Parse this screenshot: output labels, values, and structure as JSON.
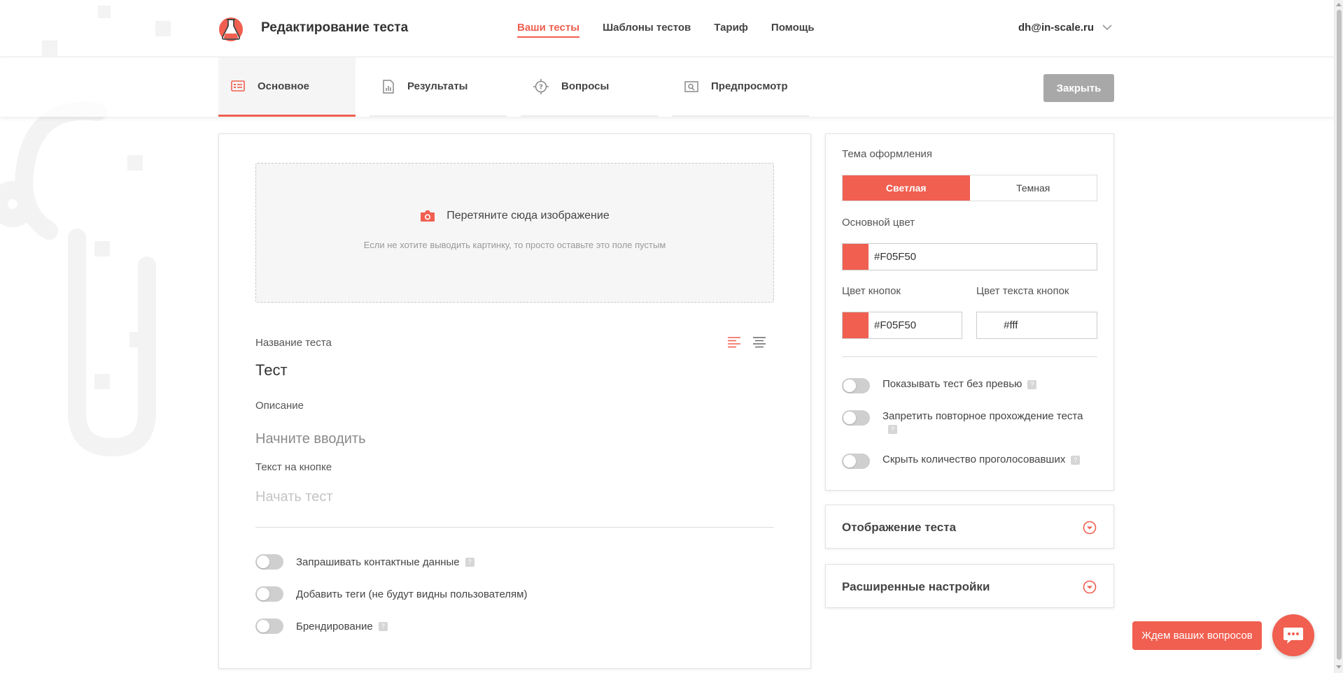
{
  "header": {
    "title": "Редактирование теста",
    "nav": [
      {
        "label": "Ваши тесты",
        "active": true
      },
      {
        "label": "Шаблоны тестов",
        "active": false
      },
      {
        "label": "Тариф",
        "active": false
      },
      {
        "label": "Помощь",
        "active": false
      }
    ],
    "user_email": "dh@in-scale.ru"
  },
  "tabs": [
    {
      "label": "Основное",
      "icon": "form-icon",
      "active": true
    },
    {
      "label": "Результаты",
      "icon": "chart-icon",
      "active": false
    },
    {
      "label": "Вопросы",
      "icon": "target-question-icon",
      "active": false
    },
    {
      "label": "Предпросмотр",
      "icon": "preview-icon",
      "active": false
    }
  ],
  "close_label": "Закрыть",
  "main": {
    "dropzone": {
      "title": "Перетяните сюда изображение",
      "hint": "Если не хотите выводить картинку, то просто оставьте это поле пустым"
    },
    "test_name_label": "Название теста",
    "test_name_value": "Тест",
    "description_label": "Описание",
    "description_placeholder": "Начните вводить",
    "button_text_label": "Текст на кнопке",
    "button_text_placeholder": "Начать тест",
    "toggles": [
      {
        "label": "Запрашивать контактные данные",
        "help": true,
        "on": false
      },
      {
        "label": "Добавить теги (не будут видны пользователям)",
        "help": false,
        "on": false
      },
      {
        "label": "Брендирование",
        "help": true,
        "on": false
      }
    ],
    "help_glyph": "?"
  },
  "sidebar": {
    "theme_label": "Тема оформления",
    "theme_options": [
      {
        "label": "Светлая",
        "active": true
      },
      {
        "label": "Темная",
        "active": false
      }
    ],
    "main_color_label": "Основной цвет",
    "main_color_value": "#F05F50",
    "button_color_label": "Цвет кнопок",
    "button_color_value": "#F05F50",
    "button_text_color_label": "Цвет текста кнопок",
    "button_text_color_value": "#fff",
    "toggles": [
      {
        "label": "Показывать тест без превью",
        "on": false
      },
      {
        "label": "Запретить повторное прохождение теста",
        "on": false
      },
      {
        "label": "Скрыть количество проголосовавших",
        "on": false
      }
    ],
    "accordion_display": "Отображение теста",
    "accordion_advanced": "Расширенные настройки"
  },
  "chat": {
    "label": "Ждем ваших вопросов"
  },
  "colors": {
    "accent": "#F05F50",
    "disabled_button": "#A8A8A8"
  }
}
